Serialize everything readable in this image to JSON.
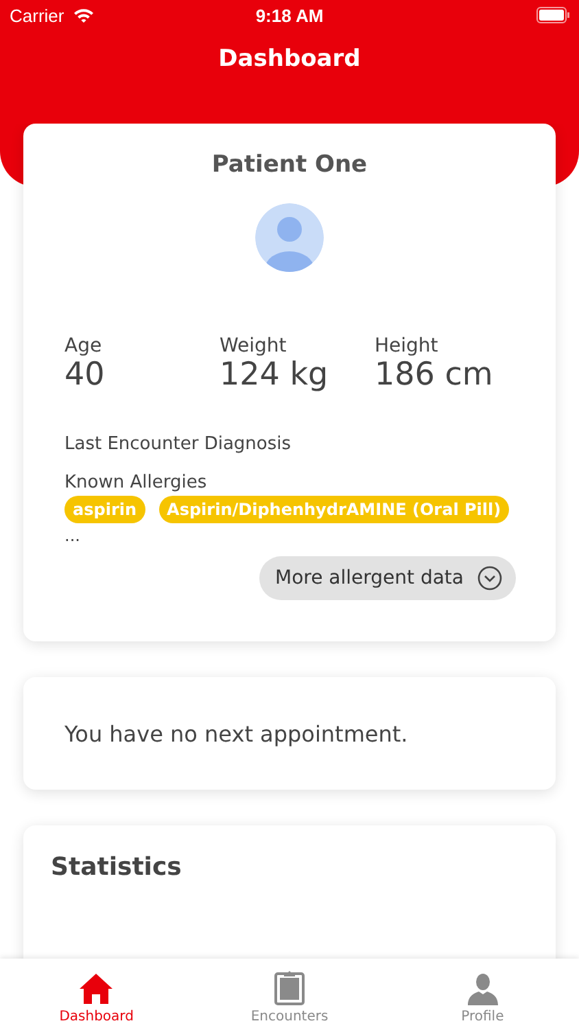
{
  "status_bar": {
    "carrier": "Carrier",
    "time": "9:18 AM"
  },
  "header": {
    "title": "Dashboard"
  },
  "patient_card": {
    "name": "Patient One",
    "stats": [
      {
        "label": "Age",
        "value": "40"
      },
      {
        "label": "Weight",
        "value": "124 kg"
      },
      {
        "label": "Height",
        "value": "186 cm"
      }
    ],
    "diagnosis_label": "Last Encounter Diagnosis",
    "allergies_label": "Known Allergies",
    "allergies": [
      "aspirin",
      "Aspirin/DiphenhydrAMINE (Oral Pill)"
    ],
    "more_marker": "...",
    "more_button": "More allergent data"
  },
  "appointment_card": {
    "text": "You have no next appointment."
  },
  "statistics_card": {
    "title": "Statistics"
  },
  "tab_bar": [
    {
      "kind": "home",
      "label": "Dashboard",
      "selected": true
    },
    {
      "kind": "clipboard",
      "label": "Encounters",
      "selected": false
    },
    {
      "kind": "person",
      "label": "Profile",
      "selected": false
    }
  ]
}
